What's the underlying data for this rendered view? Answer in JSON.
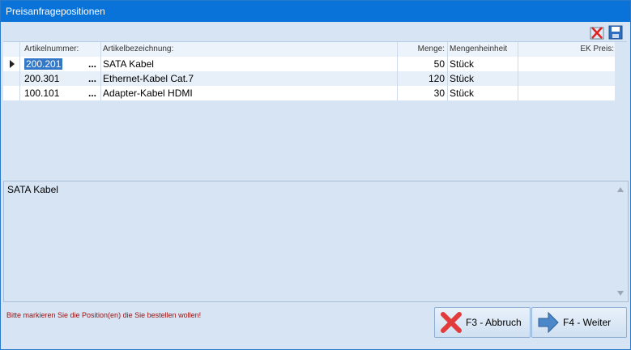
{
  "window": {
    "title": "Preisanfragepositionen"
  },
  "toolbar": {
    "delete_icon": "delete-icon",
    "save_icon": "save-icon"
  },
  "grid": {
    "columns": [
      "Artikelnummer:",
      "Artikelbezeichnung:",
      "Menge:",
      "Mengenheinheit",
      "EK Preis:"
    ],
    "rows": [
      {
        "nr": "200.201",
        "dots": "...",
        "bez": "SATA Kabel",
        "menge": "50",
        "einheit": "Stück",
        "ek": ""
      },
      {
        "nr": "200.301",
        "dots": "...",
        "bez": "Ethernet-Kabel Cat.7",
        "menge": "120",
        "einheit": "Stück",
        "ek": ""
      },
      {
        "nr": "100.101",
        "dots": "...",
        "bez": "Adapter-Kabel HDMI",
        "menge": "30",
        "einheit": "Stück",
        "ek": ""
      }
    ]
  },
  "memo": {
    "text": "SATA Kabel"
  },
  "footer": {
    "hint": "Bitte markieren Sie die Position(en) die Sie bestellen wollen!",
    "abbruch_label": "F3 - Abbruch",
    "weiter_label": "F4 - Weiter"
  },
  "colors": {
    "title_bar": "#0a73d9",
    "background": "#d6e4f3",
    "hint_text": "#a01010",
    "selection": "#3277c8"
  }
}
